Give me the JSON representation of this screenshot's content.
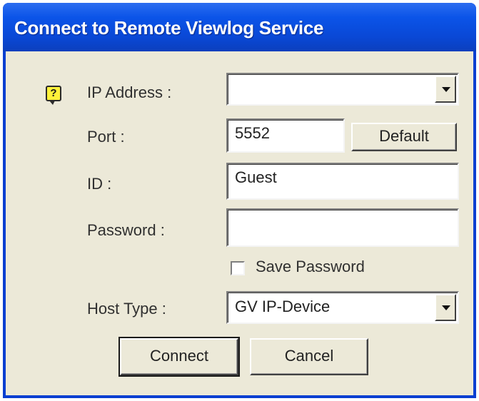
{
  "window": {
    "title": "Connect to Remote Viewlog Service"
  },
  "form": {
    "help_icon_glyph": "?",
    "ip_address": {
      "label": "IP Address :",
      "value": ""
    },
    "port": {
      "label": "Port :",
      "value": "5552",
      "default_button": "Default"
    },
    "id": {
      "label": "ID :",
      "value": "Guest"
    },
    "password": {
      "label": "Password :",
      "value": ""
    },
    "save_password": {
      "label": "Save Password",
      "checked": false
    },
    "host_type": {
      "label": "Host Type :",
      "value": "GV IP-Device"
    }
  },
  "buttons": {
    "connect": "Connect",
    "cancel": "Cancel"
  },
  "colors": {
    "titlebar": "#0a48d6",
    "dialog_face": "#ece9d8",
    "help_icon": "#fff23a"
  }
}
